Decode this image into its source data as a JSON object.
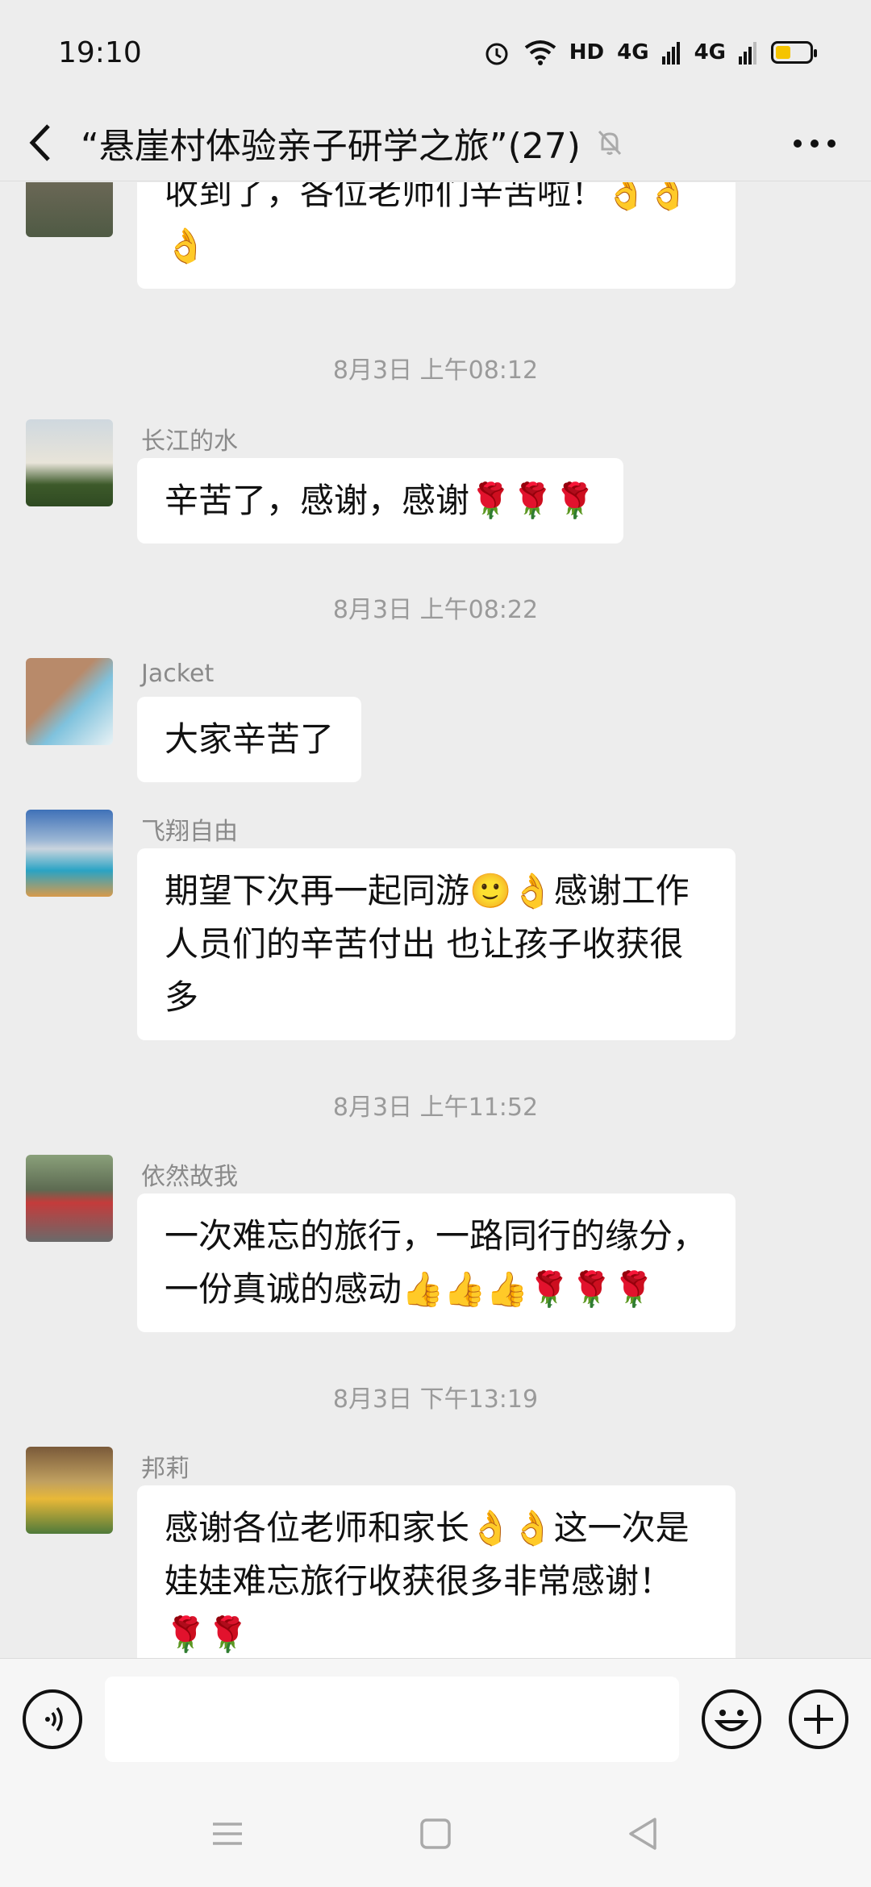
{
  "status_bar": {
    "time": "19:10",
    "network_label": "HD",
    "signal1_label": "4G",
    "signal2_label": "4G"
  },
  "header": {
    "back_icon": "chevron-left-icon",
    "title": "“悬崖村体验亲子研学之旅”(27)",
    "mute_icon": "bell-off-icon",
    "more_icon": "more-dots-icon"
  },
  "messages": [
    {
      "type": "message",
      "sender": "",
      "text": "收到了，各位老师们辛苦啦！👌👌👌"
    },
    {
      "type": "time",
      "text": "8月3日 上午08:12"
    },
    {
      "type": "message",
      "sender": "长江的水",
      "text": "辛苦了，感谢，感谢🌹🌹🌹"
    },
    {
      "type": "time",
      "text": "8月3日 上午08:22"
    },
    {
      "type": "message",
      "sender": "Jacket",
      "text": "大家辛苦了"
    },
    {
      "type": "message",
      "sender": "飞翔自由",
      "text": "期望下次再一起同游🙂👌感谢工作人员们的辛苦付出 也让孩子收获很多"
    },
    {
      "type": "time",
      "text": "8月3日 上午11:52"
    },
    {
      "type": "message",
      "sender": "依然故我",
      "text": "一次难忘的旅行，一路同行的缘分，一份真诚的感动👍👍👍🌹🌹🌹"
    },
    {
      "type": "time",
      "text": "8月3日 下午13:19"
    },
    {
      "type": "message",
      "sender": "邦莉",
      "text": "感谢各位老师和家长👌👌这一次是娃娃难忘旅行收获很多非常感谢！🌹🌹"
    }
  ],
  "input_bar": {
    "voice_icon": "voice-icon",
    "input_placeholder": "",
    "emoji_icon": "emoji-icon",
    "plus_icon": "plus-icon"
  },
  "nav_bar": {
    "menu_icon": "menu-icon",
    "home_icon": "home-square-icon",
    "back_icon": "back-triangle-icon"
  }
}
